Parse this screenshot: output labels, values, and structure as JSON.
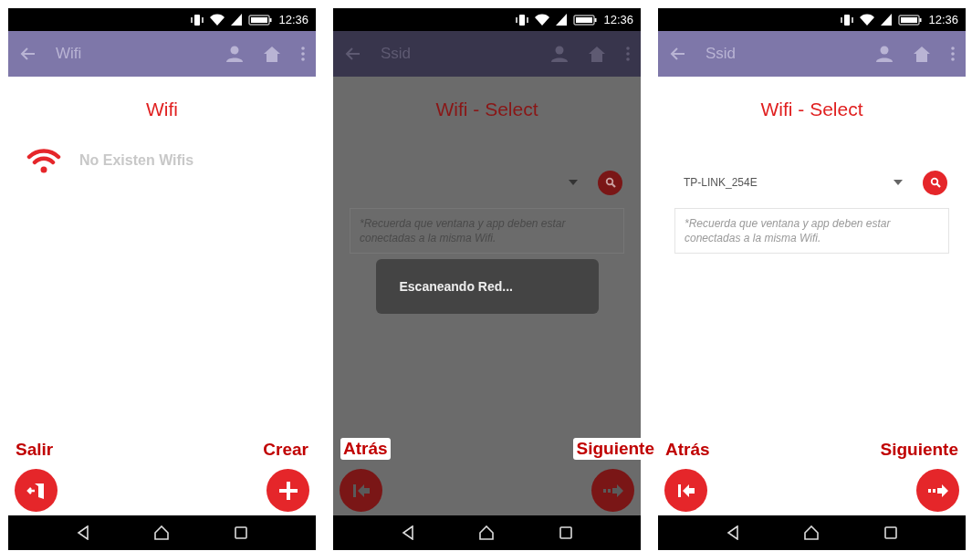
{
  "screens": [
    {
      "kind": "list",
      "dimmed": false,
      "status_time": "12:36",
      "app_bar_title": "Wifi",
      "heading": "Wifi",
      "empty_message": "No Existen Wifis",
      "actions": [
        {
          "label": "Salir",
          "kind": "exit"
        },
        {
          "label": "Crear",
          "kind": "add"
        }
      ]
    },
    {
      "kind": "select",
      "dimmed": true,
      "status_time": "12:36",
      "app_bar_title": "Ssid",
      "heading": "Wifi - Select",
      "note": "*Recuerda que ventana y app deben estar conectadas a la misma Wifi.",
      "toast": "Escaneando Red...",
      "actions": [
        {
          "label": "Atrás",
          "kind": "back"
        },
        {
          "label": "Siguiente",
          "kind": "next"
        }
      ]
    },
    {
      "kind": "select",
      "dimmed": false,
      "status_time": "12:36",
      "app_bar_title": "Ssid",
      "heading": "Wifi - Select",
      "selected_value": "TP-LINK_254E",
      "note": "*Recuerda que ventana y app deben estar conectadas a la misma Wifi.",
      "actions": [
        {
          "label": "Atrás",
          "kind": "back"
        },
        {
          "label": "Siguiente",
          "kind": "next"
        }
      ]
    }
  ]
}
